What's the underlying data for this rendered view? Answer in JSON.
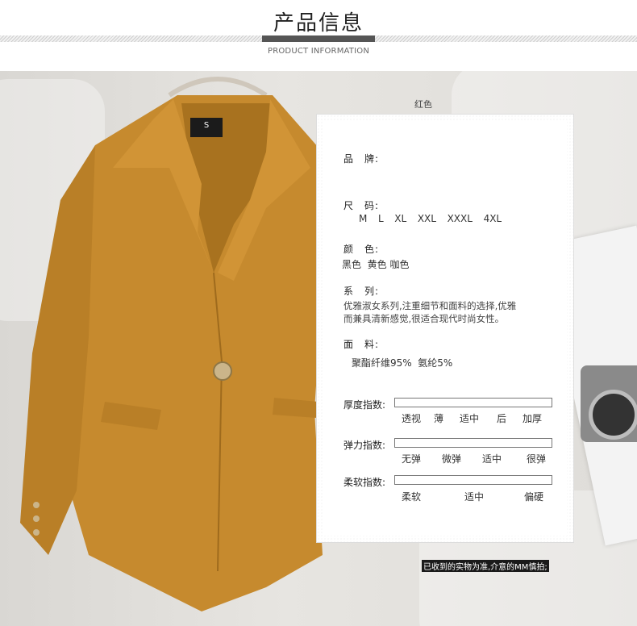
{
  "header": {
    "title": "产品信息",
    "subtitle": "PRODUCT INFORMATION"
  },
  "product_label": "红色",
  "jacket_tag": "S",
  "info": {
    "brand": {
      "label": "品　牌:"
    },
    "size": {
      "label": "尺　码:",
      "values": "M  L  XL  XXL  XXXL  4XL"
    },
    "color": {
      "label": "颜　色:",
      "values": "黑色  黄色 咖色"
    },
    "series": {
      "label": "系　列:",
      "line1": "优雅淑女系列,注重细节和面料的选择,优雅",
      "line2": "而兼具清新感觉,很适合现代时尚女性。"
    },
    "fabric": {
      "label": "面　料:",
      "value": "聚酯纤维95%  氨纶5%"
    }
  },
  "indices": {
    "thickness": {
      "label": "厚度指数:",
      "options": [
        "透视",
        "薄",
        "适中",
        "后",
        "加厚"
      ]
    },
    "elasticity": {
      "label": "弹力指数:",
      "options": [
        "无弹",
        "微弹",
        "适中",
        "很弹"
      ]
    },
    "softness": {
      "label": "柔软指数:",
      "options": [
        "柔软",
        "适中",
        "偏硬"
      ]
    }
  },
  "note": "已收到的实物为准,介意的MM慎拍;",
  "colors": {
    "jacket": "#c68a2e",
    "jacket_shadow": "#a8721f",
    "background": "#e2e0dc"
  }
}
